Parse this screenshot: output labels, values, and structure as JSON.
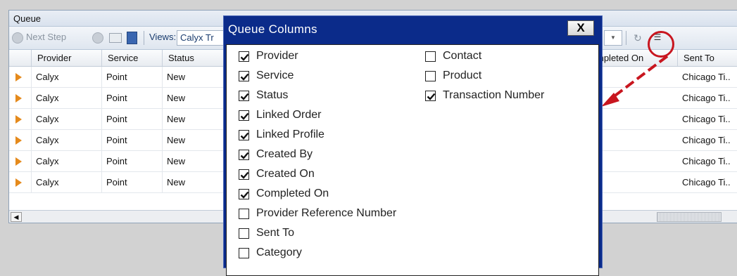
{
  "panel": {
    "title": "Queue"
  },
  "toolbar": {
    "next_step_label": "Next Step",
    "views_label": "Views:",
    "views_value": "Calyx Tr"
  },
  "grid": {
    "columns": [
      {
        "label": "Provider"
      },
      {
        "label": "Service"
      },
      {
        "label": "Status"
      },
      {
        "label": "mpleted On"
      },
      {
        "label": "Sent To"
      }
    ],
    "rows": [
      {
        "provider": "Calyx",
        "service": "Point",
        "status": "New",
        "sent_to": "Chicago Ti.."
      },
      {
        "provider": "Calyx",
        "service": "Point",
        "status": "New",
        "sent_to": "Chicago Ti.."
      },
      {
        "provider": "Calyx",
        "service": "Point",
        "status": "New",
        "sent_to": "Chicago Ti.."
      },
      {
        "provider": "Calyx",
        "service": "Point",
        "status": "New",
        "sent_to": "Chicago Ti.."
      },
      {
        "provider": "Calyx",
        "service": "Point",
        "status": "New",
        "sent_to": "Chicago Ti.."
      },
      {
        "provider": "Calyx",
        "service": "Point",
        "status": "New",
        "sent_to": "Chicago Ti.."
      }
    ]
  },
  "dialog": {
    "title": "Queue Columns",
    "close_label": "X",
    "left_column": [
      {
        "label": "Provider",
        "checked": true
      },
      {
        "label": "Service",
        "checked": true
      },
      {
        "label": "Status",
        "checked": true
      },
      {
        "label": "Linked Order",
        "checked": true
      },
      {
        "label": "Linked Profile",
        "checked": true
      },
      {
        "label": "Created By",
        "checked": true
      },
      {
        "label": "Created On",
        "checked": true
      },
      {
        "label": "Completed On",
        "checked": true
      },
      {
        "label": "Provider Reference Number",
        "checked": false
      },
      {
        "label": "Sent To",
        "checked": false
      },
      {
        "label": "Category",
        "checked": false
      }
    ],
    "right_column": [
      {
        "label": "Contact",
        "checked": false
      },
      {
        "label": "Product",
        "checked": false
      },
      {
        "label": "Transaction Number",
        "checked": true
      }
    ]
  },
  "icons": {
    "arrow_color": "#e58a1c",
    "highlight_color": "#c8161f",
    "dialog_title_bg": "#0b2b8a"
  }
}
